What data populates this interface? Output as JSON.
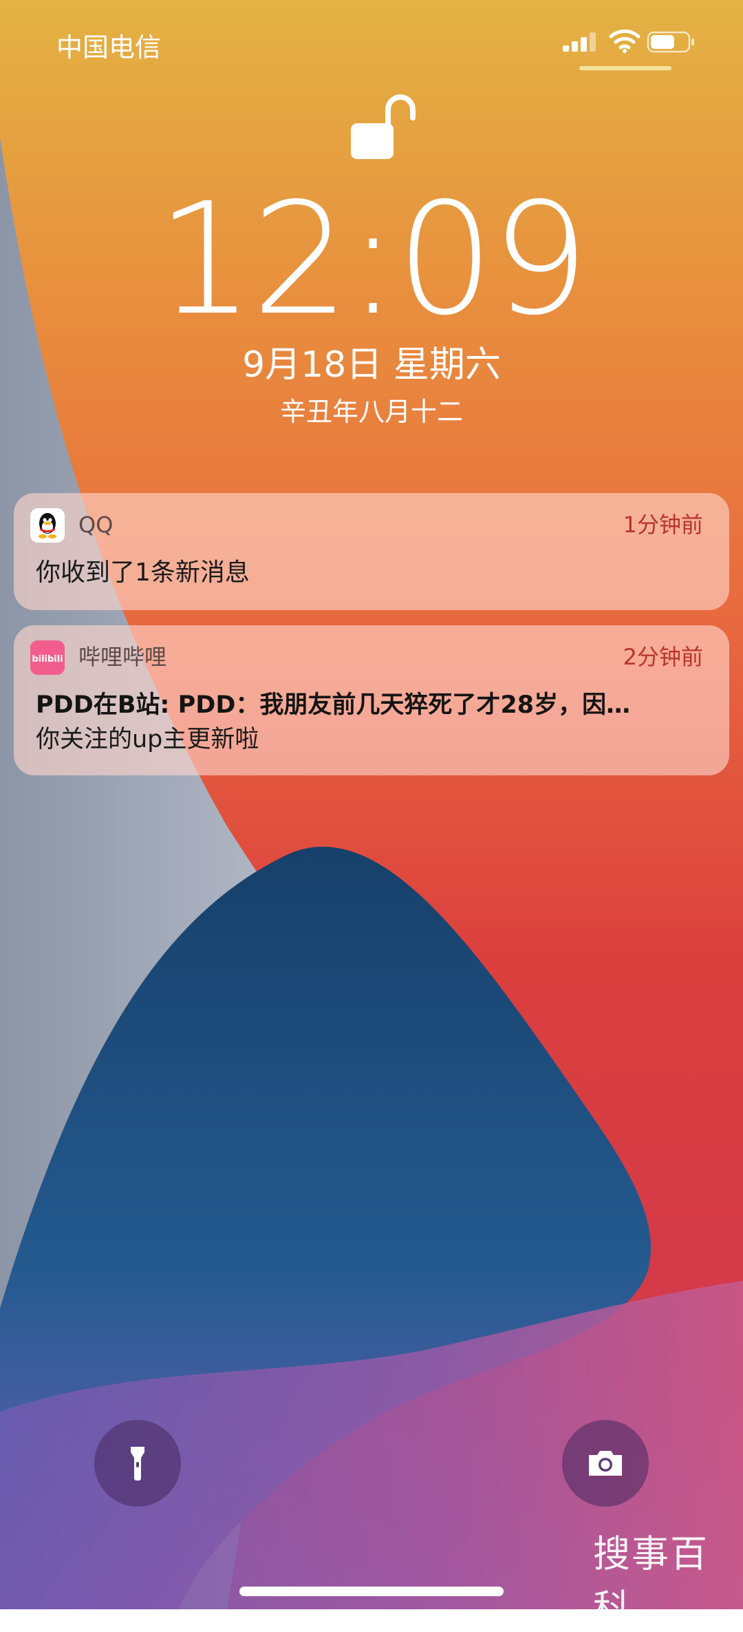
{
  "status_bar": {
    "carrier": "中国电信",
    "icons": [
      "signal-icon",
      "wifi-icon",
      "battery-icon"
    ]
  },
  "lock_screen": {
    "lock_icon": "unlocked-padlock-icon",
    "time": "12:09",
    "date": "9月18日 星期六",
    "lunar_date": "辛丑年八月十二"
  },
  "notifications": [
    {
      "app_name": "QQ",
      "time_ago": "1分钟前",
      "body": "你收到了1条新消息"
    },
    {
      "app_name": "哔哩哔哩",
      "icon_label": "bilibili",
      "time_ago": "2分钟前",
      "title": "PDD在B站: PDD：我朋友前几天猝死了才28岁，因…",
      "body": "你关注的up主更新啦"
    }
  ],
  "quick_actions": {
    "left": "flashlight-icon",
    "right": "camera-icon"
  },
  "watermark": "搜事百科",
  "colors": {
    "wallpaper_top": "#E3AE41",
    "wallpaper_orange": "#E98540",
    "wallpaper_red": "#D8393C",
    "wallpaper_blue": "#17446B",
    "wallpaper_purple": "#8E5AA8",
    "notification_time": "#B8352C"
  }
}
